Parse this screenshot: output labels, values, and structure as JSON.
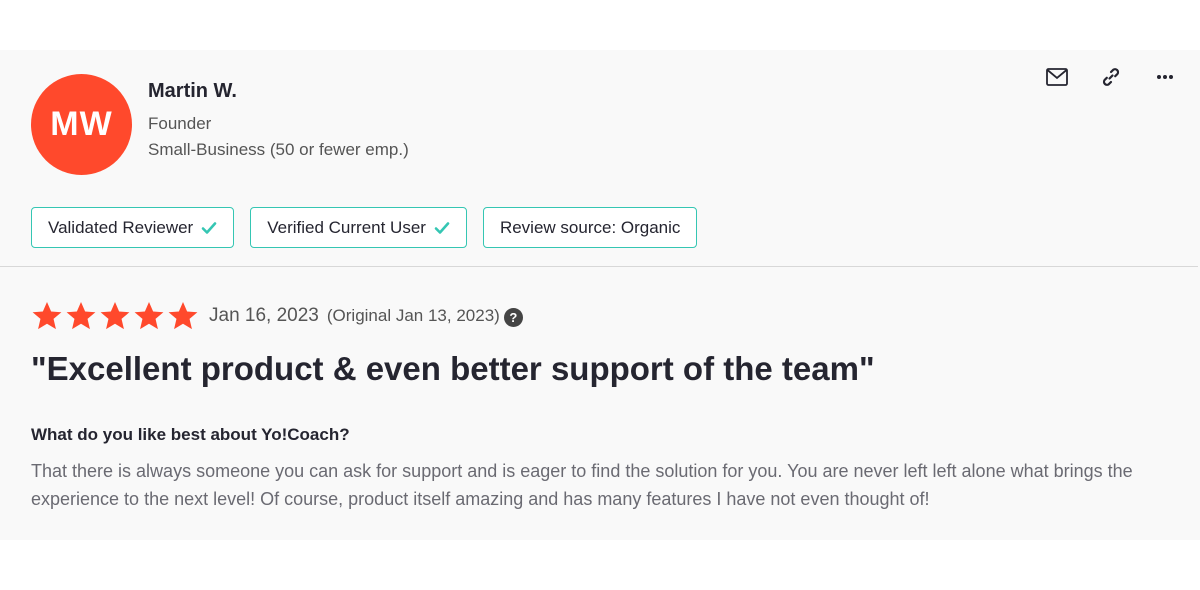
{
  "reviewer": {
    "initials": "MW",
    "name": "Martin W.",
    "title": "Founder",
    "segment": "Small-Business (50 or fewer emp.)",
    "avatar_color": "#ff492c"
  },
  "actions": [
    {
      "icon": "envelope-icon"
    },
    {
      "icon": "link-icon"
    },
    {
      "icon": "more-options-icon"
    }
  ],
  "badges": [
    {
      "label": "Validated Reviewer",
      "verified": true
    },
    {
      "label": "Verified Current User",
      "verified": true
    },
    {
      "label": "Review source: Organic",
      "verified": false
    }
  ],
  "review": {
    "rating": 5,
    "max_rating": 5,
    "date": "Jan 16, 2023",
    "original_date": "(Original Jan 13, 2023)",
    "title": "\"Excellent product & even better support of the team\"",
    "question": "What do you like best about Yo!Coach?",
    "answer": "That there is always someone you can ask for support and is eager to find the solution for you. You are never left left alone what brings the experience to the next level! Of course, product itself amazing and has many features I have not even thought of!"
  },
  "colors": {
    "star": "#ff492c",
    "badge_border": "#35c6b3",
    "check": "#35c6b3"
  }
}
